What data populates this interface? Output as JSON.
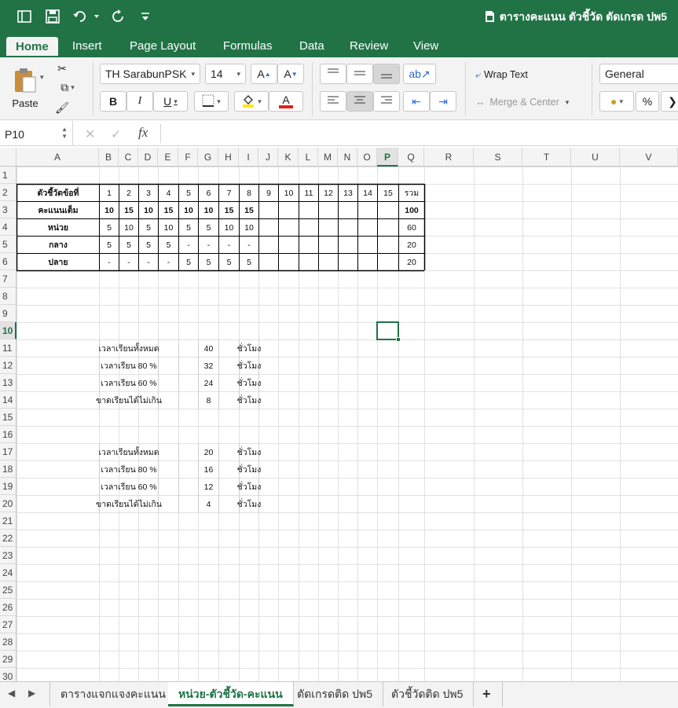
{
  "window": {
    "title": "ตารางคะแนน ตัวชี้วัด ตัดเกรด ปพ5"
  },
  "ribbon_tabs": [
    "Home",
    "Insert",
    "Page Layout",
    "Formulas",
    "Data",
    "Review",
    "View"
  ],
  "ribbon": {
    "paste_label": "Paste",
    "font_name": "TH SarabunPSK",
    "font_size": "14",
    "bold": "B",
    "italic": "I",
    "underline": "U",
    "grow": "A",
    "shrink": "A",
    "wrap_text": "Wrap Text",
    "merge_center": "Merge & Center",
    "number_format": "General",
    "percent": "%",
    "font_color": "#e02020",
    "fill_color": "#ffe800"
  },
  "formula_bar": {
    "name_box": "P10",
    "fx": "fx",
    "content": ""
  },
  "columns": [
    "A",
    "B",
    "C",
    "D",
    "E",
    "F",
    "G",
    "H",
    "I",
    "J",
    "K",
    "L",
    "M",
    "N",
    "O",
    "P",
    "Q",
    "R",
    "S",
    "T",
    "U",
    "V"
  ],
  "selected_column": "P",
  "selected_row": "10",
  "rows": [
    "1",
    "2",
    "3",
    "4",
    "5",
    "6",
    "7",
    "8",
    "9",
    "10",
    "11",
    "12",
    "13",
    "14",
    "15",
    "16",
    "17",
    "18",
    "19",
    "20",
    "21",
    "22",
    "23",
    "24",
    "25",
    "26",
    "27",
    "28",
    "29",
    "30"
  ],
  "table1": {
    "header": [
      "ตัวชี้วัดข้อที่",
      "1",
      "2",
      "3",
      "4",
      "5",
      "6",
      "7",
      "8",
      "9",
      "10",
      "11",
      "12",
      "13",
      "14",
      "15",
      "รวม"
    ],
    "rows": [
      [
        "คะแนนเต็ม",
        "10",
        "15",
        "10",
        "15",
        "10",
        "10",
        "15",
        "15",
        "",
        "",
        "",
        "",
        "",
        "",
        "",
        "100"
      ],
      [
        "หน่วย",
        "5",
        "10",
        "5",
        "10",
        "5",
        "5",
        "10",
        "10",
        "",
        "",
        "",
        "",
        "",
        "",
        "",
        "60"
      ],
      [
        "กลาง",
        "5",
        "5",
        "5",
        "5",
        "-",
        "-",
        "-",
        "-",
        "",
        "",
        "",
        "",
        "",
        "",
        "",
        "20"
      ],
      [
        "ปลาย",
        "-",
        "-",
        "-",
        "-",
        "5",
        "5",
        "5",
        "5",
        "",
        "",
        "",
        "",
        "",
        "",
        "",
        "20"
      ]
    ]
  },
  "hours1": [
    {
      "label": "เวลาเรียนทั้งหมด",
      "value": "40",
      "unit": "ชั่วโมง"
    },
    {
      "label": "เวลาเรียน 80 %",
      "value": "32",
      "unit": "ชั่วโมง"
    },
    {
      "label": "เวลาเรียน 60 %",
      "value": "24",
      "unit": "ชั่วโมง"
    },
    {
      "label": "ขาดเรียนได้ไม่เกิน",
      "value": "8",
      "unit": "ชั่วโมง"
    }
  ],
  "hours2": [
    {
      "label": "เวลาเรียนทั้งหมด",
      "value": "20",
      "unit": "ชั่วโมง"
    },
    {
      "label": "เวลาเรียน 80 %",
      "value": "16",
      "unit": "ชั่วโมง"
    },
    {
      "label": "เวลาเรียน 60 %",
      "value": "12",
      "unit": "ชั่วโมง"
    },
    {
      "label": "ขาดเรียนได้ไม่เกิน",
      "value": "4",
      "unit": "ชั่วโมง"
    }
  ],
  "sheet_tabs": [
    "ตารางแจกแจงคะแนน",
    "หน่วย-ตัวชี้วัด-คะแนน",
    "ตัดเกรดติด ปพ5",
    "ตัวชี้วัดติด ปพ5"
  ],
  "active_sheet": 1,
  "add_sheet": "+",
  "accent": "#217346"
}
